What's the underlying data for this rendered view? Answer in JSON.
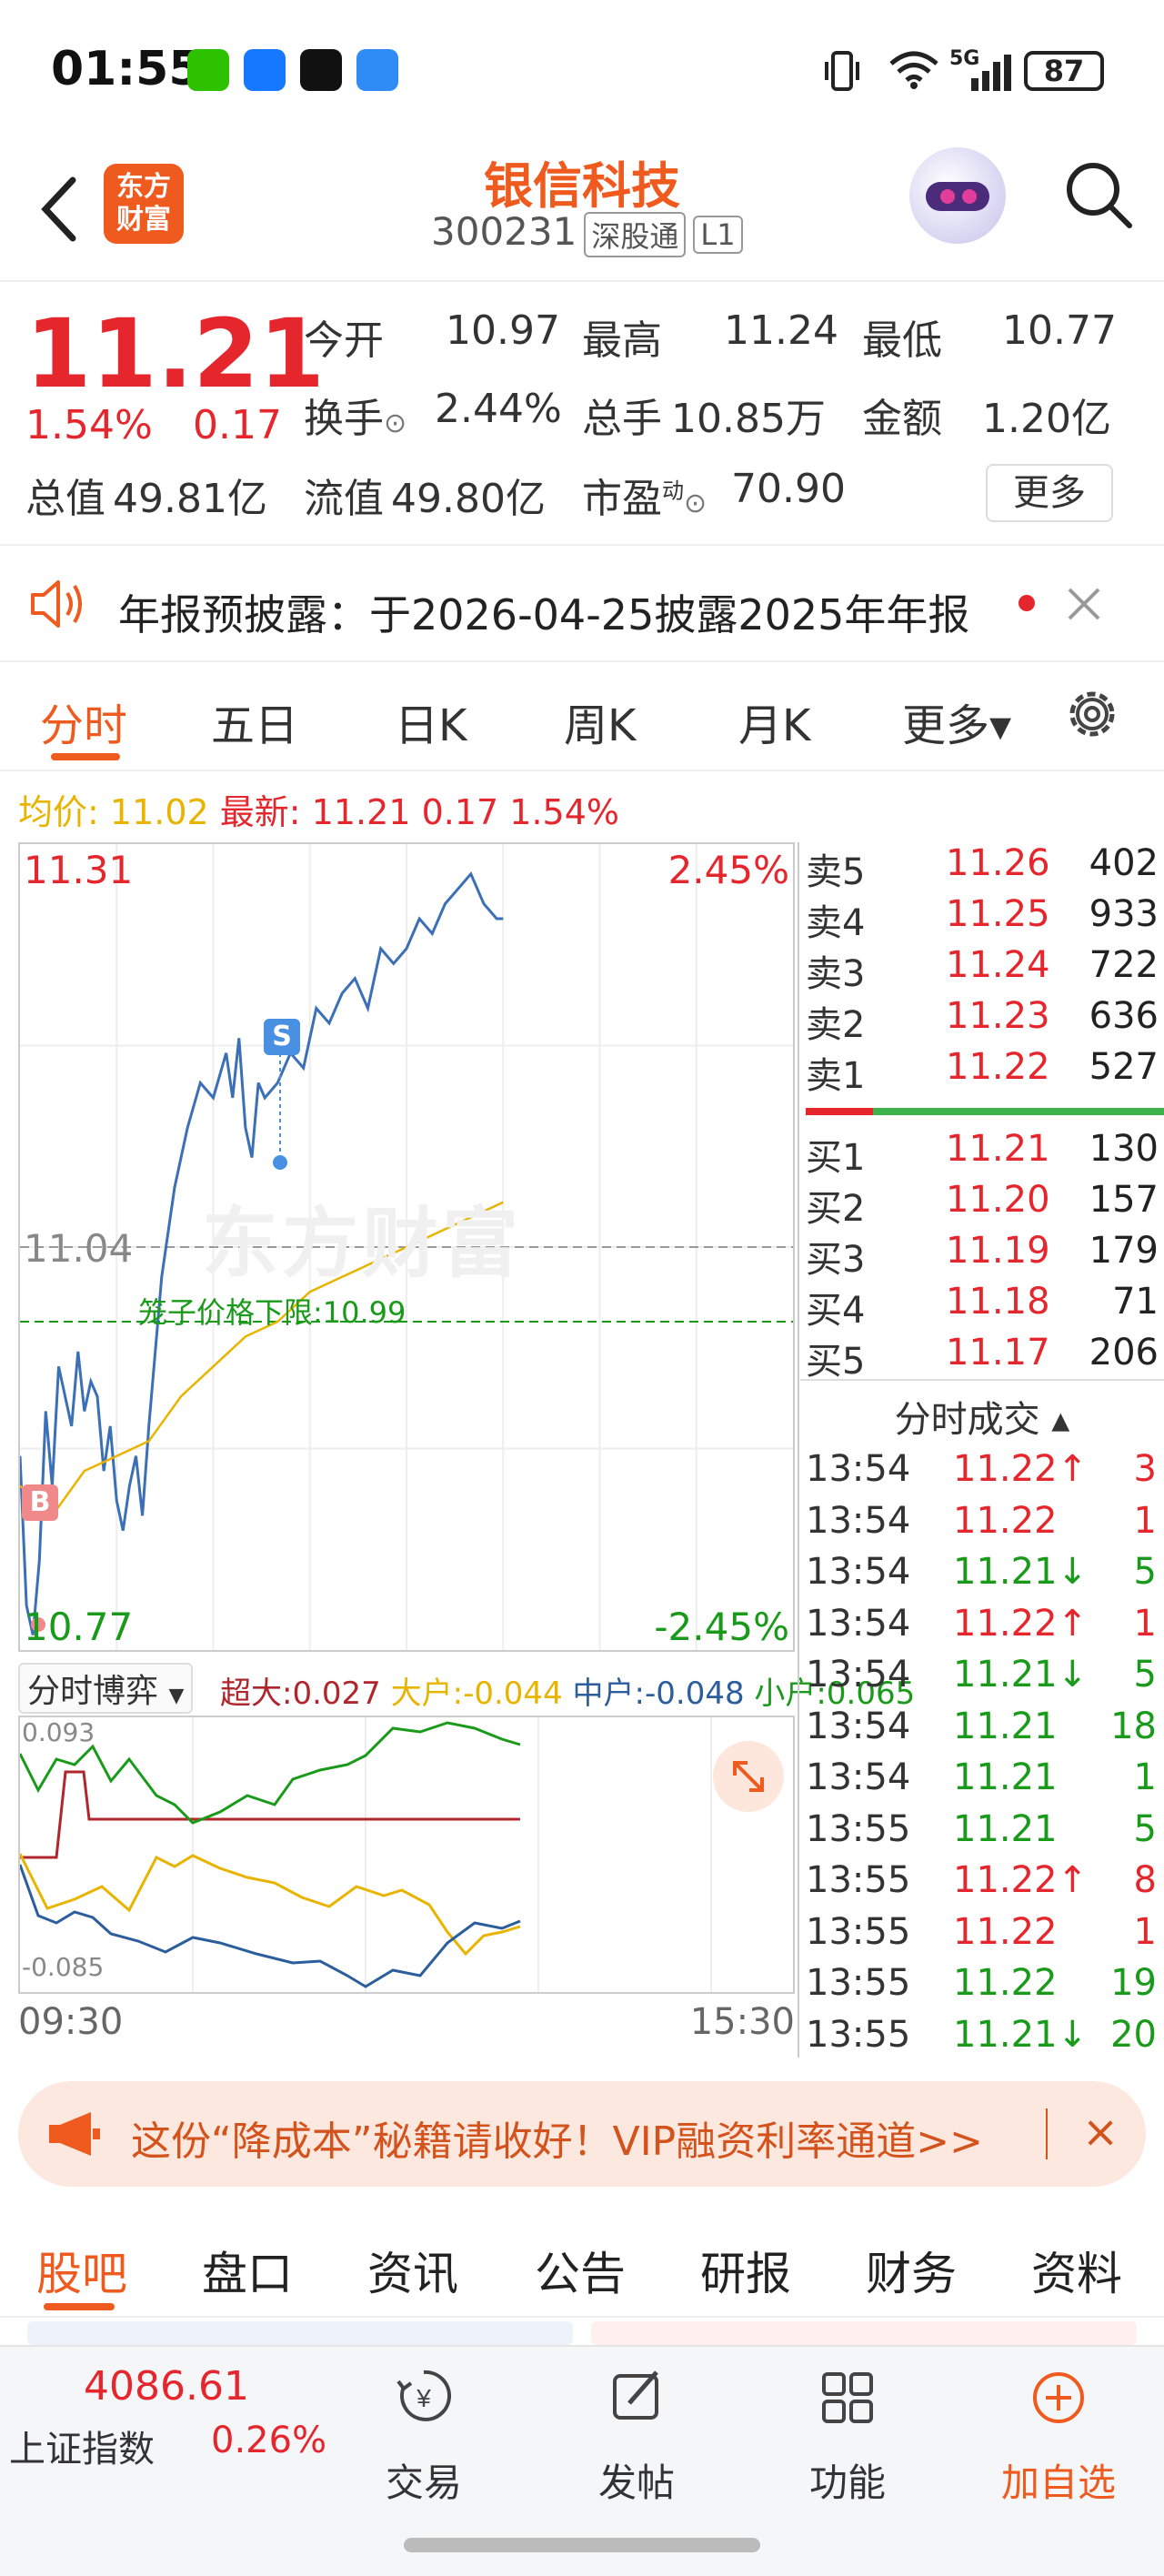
{
  "status_bar": {
    "time": "01:55",
    "network": "5G",
    "battery": "87"
  },
  "header": {
    "logo": [
      "东方",
      "财富"
    ],
    "stock_name": "银信科技",
    "stock_code": "300231",
    "tag_connect": "深股通",
    "tag_level": "L1"
  },
  "quote": {
    "price": "11.21",
    "change_pct": "1.54%",
    "change_amt": "0.17",
    "open_label": "今开",
    "open": "10.97",
    "high_label": "最高",
    "high": "11.24",
    "low_label": "最低",
    "low": "10.77",
    "turnover_label": "换手",
    "turnover": "2.44%",
    "volume_label": "总手",
    "volume": "10.85万",
    "amount_label": "金额",
    "amount": "1.20亿",
    "mktcap_label": "总值",
    "mktcap": "49.81亿",
    "float_label": "流值",
    "float": "49.80亿",
    "pe_label": "市盈",
    "pe_sup": "动",
    "pe": "70.90",
    "more": "更多"
  },
  "notice": {
    "text": "年报预披露：于2026-04-25披露2025年年报"
  },
  "chart_tabs": [
    "分时",
    "五日",
    "日K",
    "周K",
    "月K",
    "更多▾"
  ],
  "avg_info": {
    "avg_label": "均价:",
    "avg": "11.02",
    "last_label": "最新:",
    "last": "11.21",
    "chg": "0.17",
    "pct": "1.54%"
  },
  "chart_labels": {
    "top_price": "11.31",
    "top_pct": "2.45%",
    "mid_price": "11.04",
    "bottom_price": "10.77",
    "bottom_pct": "-2.45%",
    "limit_text": "笼子价格下限:10.99",
    "watermark": "东方财富",
    "s_marker": "S",
    "b_marker": "B"
  },
  "chart_data": [
    {
      "type": "line",
      "title": "",
      "x_range": [
        "09:30",
        "15:30"
      ],
      "ylim": [
        10.77,
        11.31
      ],
      "y_right_range": [
        "-2.45%",
        "2.45%"
      ],
      "ref_line": 11.04,
      "limit_line": 10.99,
      "series": [
        {
          "name": "",
          "color": "#3b6fb6",
          "points": [
            [
              0,
              10.9
            ],
            [
              2,
              10.8
            ],
            [
              4,
              10.78
            ],
            [
              6,
              10.83
            ],
            [
              8,
              10.93
            ],
            [
              10,
              10.88
            ],
            [
              12,
              10.96
            ],
            [
              14,
              10.94
            ],
            [
              16,
              10.92
            ],
            [
              18,
              10.97
            ],
            [
              20,
              10.93
            ],
            [
              22,
              10.95
            ],
            [
              24,
              10.94
            ],
            [
              26,
              10.89
            ],
            [
              28,
              10.92
            ],
            [
              30,
              10.87
            ],
            [
              32,
              10.85
            ],
            [
              34,
              10.88
            ],
            [
              36,
              10.9
            ],
            [
              38,
              10.86
            ],
            [
              40,
              10.92
            ],
            [
              44,
              11.02
            ],
            [
              48,
              11.08
            ],
            [
              52,
              11.12
            ],
            [
              56,
              11.15
            ],
            [
              60,
              11.14
            ],
            [
              64,
              11.17
            ],
            [
              66,
              11.14
            ],
            [
              68,
              11.18
            ],
            [
              70,
              11.12
            ],
            [
              72,
              11.1
            ],
            [
              74,
              11.15
            ],
            [
              76,
              11.14
            ],
            [
              80,
              11.15
            ],
            [
              84,
              11.17
            ],
            [
              88,
              11.16
            ],
            [
              92,
              11.2
            ],
            [
              96,
              11.19
            ],
            [
              100,
              11.21
            ],
            [
              104,
              11.22
            ],
            [
              108,
              11.2
            ],
            [
              112,
              11.24
            ],
            [
              116,
              11.23
            ],
            [
              120,
              11.24
            ],
            [
              124,
              11.26
            ],
            [
              128,
              11.25
            ],
            [
              132,
              11.27
            ],
            [
              136,
              11.28
            ],
            [
              140,
              11.29
            ],
            [
              144,
              11.27
            ],
            [
              148,
              11.26
            ],
            [
              150,
              11.26
            ]
          ]
        },
        {
          "name": "均价",
          "color": "#e8b400",
          "points": [
            [
              0,
              10.88
            ],
            [
              10,
              10.86
            ],
            [
              20,
              10.89
            ],
            [
              30,
              10.9
            ],
            [
              40,
              10.91
            ],
            [
              50,
              10.94
            ],
            [
              60,
              10.96
            ],
            [
              70,
              10.98
            ],
            [
              80,
              10.99
            ],
            [
              90,
              11.01
            ],
            [
              100,
              11.02
            ],
            [
              110,
              11.03
            ],
            [
              120,
              11.04
            ],
            [
              130,
              11.05
            ],
            [
              140,
              11.06
            ],
            [
              150,
              11.07
            ]
          ]
        }
      ]
    },
    {
      "type": "line",
      "title": "分时博弈",
      "ylim": [
        -0.085,
        0.093
      ],
      "series": [
        {
          "name": "超大",
          "value": "0.027",
          "color": "#b0262d"
        },
        {
          "name": "大户",
          "value": "-0.044",
          "color": "#e8b400"
        },
        {
          "name": "中户",
          "value": "-0.048",
          "color": "#2c5d9c"
        },
        {
          "name": "小户",
          "value": "0.065",
          "color": "#1a9a1a"
        }
      ]
    }
  ],
  "sub_chart": {
    "title": "分时博弈",
    "top": "0.093",
    "bottom": "-0.085",
    "legend": [
      {
        "label": "超大:",
        "value": "0.027"
      },
      {
        "label": "大户:",
        "value": "-0.044"
      },
      {
        "label": "中户:",
        "value": "-0.048"
      },
      {
        "label": "小户:",
        "value": "0.065"
      }
    ]
  },
  "time_axis": {
    "start": "09:30",
    "end": "15:30"
  },
  "order_book": {
    "asks": [
      {
        "label": "卖5",
        "price": "11.26",
        "vol": "402"
      },
      {
        "label": "卖4",
        "price": "11.25",
        "vol": "933"
      },
      {
        "label": "卖3",
        "price": "11.24",
        "vol": "722"
      },
      {
        "label": "卖2",
        "price": "11.23",
        "vol": "636"
      },
      {
        "label": "卖1",
        "price": "11.22",
        "vol": "527"
      }
    ],
    "bids": [
      {
        "label": "买1",
        "price": "11.21",
        "vol": "130"
      },
      {
        "label": "买2",
        "price": "11.20",
        "vol": "157"
      },
      {
        "label": "买3",
        "price": "11.19",
        "vol": "179"
      },
      {
        "label": "买4",
        "price": "11.18",
        "vol": "71"
      },
      {
        "label": "买5",
        "price": "11.17",
        "vol": "206"
      }
    ],
    "trades_title": "分时成交 ▴",
    "trades": [
      {
        "time": "13:54",
        "price": "11.22↑",
        "vol": "3",
        "dir": "up"
      },
      {
        "time": "13:54",
        "price": "11.22",
        "vol": "1",
        "dir": "up"
      },
      {
        "time": "13:54",
        "price": "11.21↓",
        "vol": "5",
        "dir": "down"
      },
      {
        "time": "13:54",
        "price": "11.22↑",
        "vol": "1",
        "dir": "up"
      },
      {
        "time": "13:54",
        "price": "11.21↓",
        "vol": "5",
        "dir": "down"
      },
      {
        "time": "13:54",
        "price": "11.21",
        "vol": "18",
        "dir": "down"
      },
      {
        "time": "13:54",
        "price": "11.21",
        "vol": "1",
        "dir": "down"
      },
      {
        "time": "13:55",
        "price": "11.21",
        "vol": "5",
        "dir": "down"
      },
      {
        "time": "13:55",
        "price": "11.22↑",
        "vol": "8",
        "dir": "up"
      },
      {
        "time": "13:55",
        "price": "11.22",
        "vol": "1",
        "dir": "up"
      },
      {
        "time": "13:55",
        "price": "11.22",
        "vol": "19",
        "dir": "down"
      },
      {
        "time": "13:55",
        "price": "11.21↓",
        "vol": "20",
        "dir": "down"
      }
    ]
  },
  "promo": {
    "text": "这份“降成本”秘籍请收好！VIP融资利率通道>>"
  },
  "bottom_tabs": [
    "股吧",
    "盘口",
    "资讯",
    "公告",
    "研报",
    "财务",
    "资料"
  ],
  "footer": {
    "index_value": "4086.61",
    "index_name": "上证指数",
    "index_change": "0.26%",
    "buttons": [
      "交易",
      "发帖",
      "功能",
      "加自选"
    ]
  }
}
